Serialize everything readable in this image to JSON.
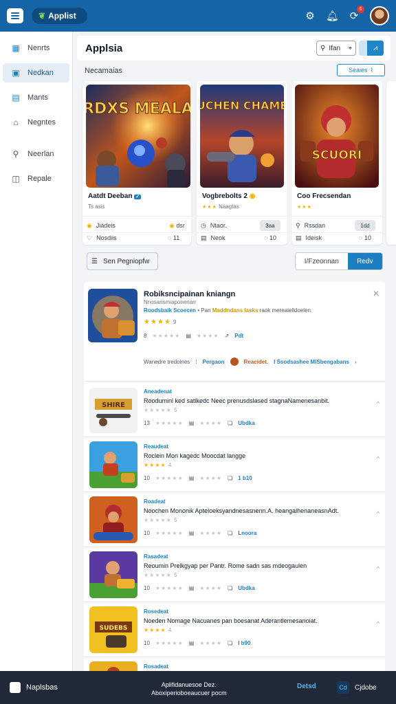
{
  "app": {
    "brand": "Applist",
    "brand_icon": "leaf-icon"
  },
  "topbar": {
    "notification_count": "6"
  },
  "sidebar": {
    "items": [
      {
        "label": "Nenrts",
        "icon": "calendar-icon"
      },
      {
        "label": "Nedkan",
        "icon": "grid-icon"
      },
      {
        "label": "Mants",
        "icon": "list-icon"
      },
      {
        "label": "Negntes",
        "icon": "home-icon"
      },
      {
        "label": "Neerlan",
        "icon": "user-icon"
      },
      {
        "label": "Repale",
        "icon": "report-icon"
      }
    ]
  },
  "header": {
    "title": "Applsia",
    "search_placeholder": "Ifan",
    "section_label": "Necamaias",
    "section_button": "Seaies"
  },
  "featured": [
    {
      "art_title": "SARDXS MEALARA",
      "title": "Aatdt Deeban",
      "sub": "Ts asis",
      "row1": "Jiadeis",
      "row1_right": "dsr",
      "row2": "Nosdiis",
      "row2_right": "11"
    },
    {
      "art_title": "SUCHEN CHAMES",
      "title": "Vogbrebolts 2",
      "sub": "Naagtas",
      "row1": "Ntaor.",
      "pill": "3aa",
      "row2": "Neok",
      "row2_right": "10"
    },
    {
      "art_title": "SCUORI",
      "title": "Coo Frecsendan",
      "sub": "",
      "row1": "Rssdan",
      "pill": "1dd",
      "row2": "Ideisk",
      "row2_right": "10"
    }
  ],
  "filter": {
    "label": "Sen Pegniopfw"
  },
  "segment": {
    "option1": "I/Fzeonnan",
    "option2": "Redv"
  },
  "list": {
    "first": {
      "title": "Robiksncipainan kniangn",
      "sub": "Nnosansmiaponenarr",
      "desc_blue": "Roodsbaik Scoecen",
      "desc_mid": " • Pan",
      "desc_yellow": "Maddndans lasks",
      "desc_rest": " raok mereaielldoelen.",
      "rating_num": "9",
      "meta_num": "8",
      "meta_action": "Pdt",
      "tag_text": "Wanedre tredolnes",
      "tag1": "Pergaon",
      "tag2": "Reacidet.",
      "tag3": "I Ssodsashee MiSbengabans"
    },
    "rows": [
      {
        "cat": "Aneadenat",
        "title": "Rooduminl ked satikedc Neec prenusdslased stagnaNamenesanbit.",
        "stars": "5",
        "num": "13",
        "action": "Ubdka"
      },
      {
        "cat": "Reaudeat",
        "title": "Roclein Mon kagedc Moocdat langge",
        "stars": "4",
        "num": "10",
        "action": "1 b10"
      },
      {
        "cat": "Roadeat",
        "title": "Noochen Mononik Apteloeksyandnesasnenn.A. heangalhenaneasnAdt.",
        "stars": "5",
        "num": "10",
        "action": "Lnoora"
      },
      {
        "cat": "Rasadeat",
        "title": "Reoumin Prelkgyap per Pantr. Rome sadn sas mdeogaulen",
        "stars": "5",
        "num": "10",
        "action": "Ubdka"
      },
      {
        "cat": "Rosedeat",
        "title": "Noeden Nomage Nacuanes pan boesanat Aderantlemesanoiat.",
        "stars": "4",
        "num": "10",
        "action": "I b90"
      },
      {
        "cat": "Rosadeat",
        "title": "",
        "stars": "",
        "num": "",
        "action": ""
      }
    ]
  },
  "footer": {
    "brand": "Naplsbas",
    "center_line1": "Aplifidanuesoe Dez.",
    "center_line2": "Aboxiperioboeaucuer pocm",
    "link": "Detsd",
    "badge": "Cd",
    "end": "Cjdobe"
  },
  "colors": {
    "topbar": "#1565a6",
    "accent": "#1d7fc1",
    "star": "#f0b400",
    "footer": "#1f2937"
  }
}
